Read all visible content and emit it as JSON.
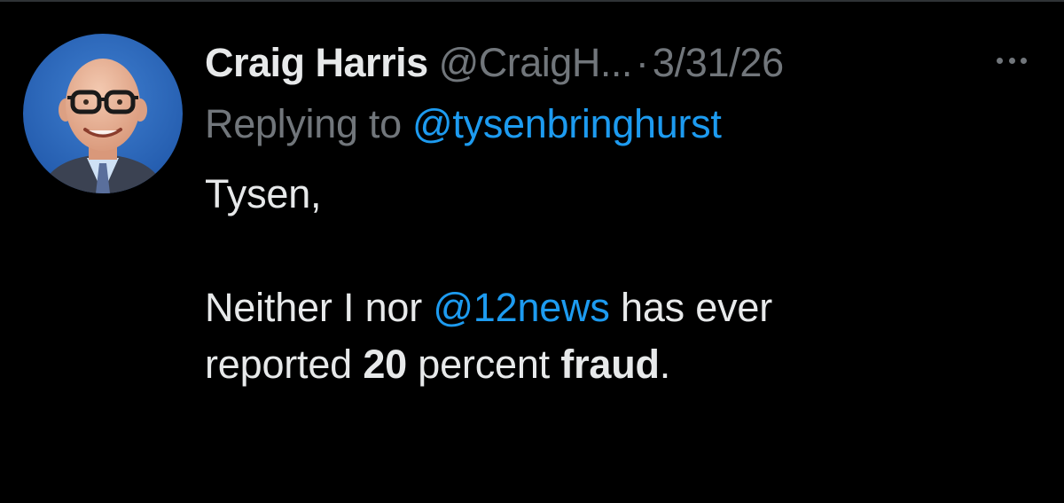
{
  "tweet": {
    "author": {
      "name": "Craig Harris",
      "handle": "@CraigH...",
      "avatar_icon": "profile-photo"
    },
    "separator": "·",
    "date": "3/31/26",
    "more_icon": "more-horizontal-icon",
    "reply": {
      "prefix": "Replying to ",
      "mention": "@tysenbringhurst"
    },
    "body": {
      "greeting": "Tysen,",
      "line1_a": "Neither I nor ",
      "line1_mention": "@12news",
      "line1_b": " has ever",
      "line2_a": "reported ",
      "line2_bold1": "20",
      "line2_b": " percent ",
      "line2_bold2": "fraud",
      "line2_c": "."
    }
  },
  "colors": {
    "background": "#000000",
    "text_primary": "#e7e9ea",
    "text_secondary": "#71767b",
    "accent": "#1d9bf0"
  }
}
